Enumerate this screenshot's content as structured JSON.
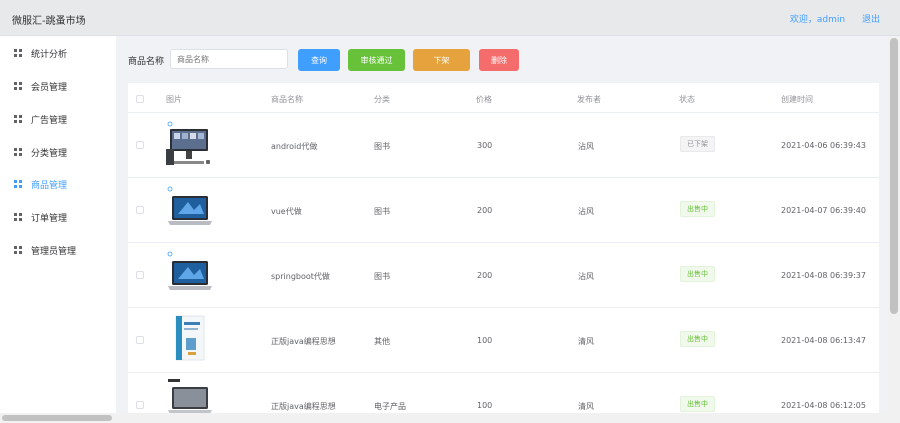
{
  "app": {
    "title": "微服汇-跳蚤市场"
  },
  "header": {
    "welcome": "欢迎，admin",
    "logout": "退出"
  },
  "sidebar": {
    "items": [
      {
        "label": "统计分析",
        "active": false
      },
      {
        "label": "会员管理",
        "active": false
      },
      {
        "label": "广告管理",
        "active": false
      },
      {
        "label": "分类管理",
        "active": false
      },
      {
        "label": "商品管理",
        "active": true
      },
      {
        "label": "订单管理",
        "active": false
      },
      {
        "label": "管理员管理",
        "active": false
      }
    ]
  },
  "search": {
    "label": "商品名称",
    "placeholder": "商品名称"
  },
  "toolbar": {
    "query": "查询",
    "audit": "审核通过",
    "off_shelf": "下架",
    "delete": "删除"
  },
  "table": {
    "headers": {
      "image": "图片",
      "name": "商品名称",
      "category": "分类",
      "price": "价格",
      "publisher": "发布者",
      "status": "状态",
      "created": "创建时间"
    },
    "rows": [
      {
        "image_icon": "desktop-pc-icon",
        "name": "android代做",
        "category": "图书",
        "price": "300",
        "publisher": "沾风",
        "status": "已下架",
        "status_type": "off",
        "created": "2021-04-06 06:39:43"
      },
      {
        "image_icon": "laptop-icon",
        "name": "vue代做",
        "category": "图书",
        "price": "200",
        "publisher": "沾风",
        "status": "出售中",
        "status_type": "on",
        "created": "2021-04-07 06:39:40"
      },
      {
        "image_icon": "laptop-icon",
        "name": "springboot代做",
        "category": "图书",
        "price": "200",
        "publisher": "沾风",
        "status": "出售中",
        "status_type": "on",
        "created": "2021-04-08 06:39:37"
      },
      {
        "image_icon": "book-icon",
        "name": "正版java编程思想",
        "category": "其他",
        "price": "100",
        "publisher": "清风",
        "status": "出售中",
        "status_type": "on",
        "created": "2021-04-08 06:13:47"
      },
      {
        "image_icon": "laptop-icon",
        "name": "正版java编程思想",
        "category": "电子产品",
        "price": "100",
        "publisher": "清风",
        "status": "出售中",
        "status_type": "on",
        "created": "2021-04-08 06:12:05"
      }
    ]
  },
  "colors": {
    "primary": "#409eff",
    "success": "#67c23a",
    "warning": "#e6a23c",
    "danger": "#f56c6c"
  }
}
